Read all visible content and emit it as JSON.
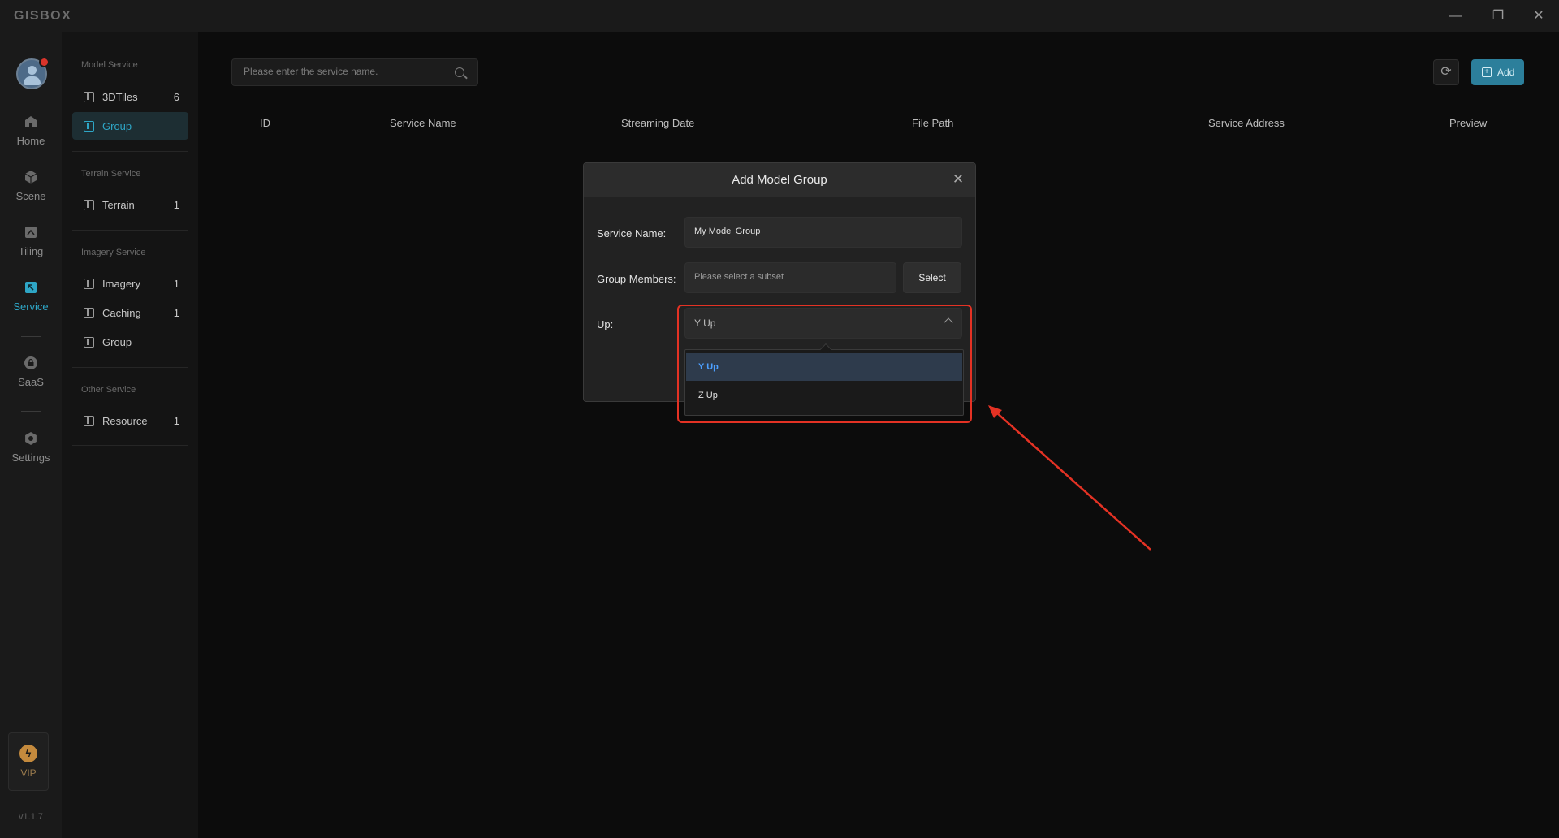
{
  "app": {
    "logo": "GISBOX",
    "version": "v1.1.7"
  },
  "window_controls": {
    "minimize": "—",
    "restore": "❐",
    "close": "✕"
  },
  "rail": {
    "items": [
      {
        "label": "Home",
        "icon": "home-icon"
      },
      {
        "label": "Scene",
        "icon": "cube-icon"
      },
      {
        "label": "Tiling",
        "icon": "tiling-icon"
      },
      {
        "label": "Service",
        "icon": "service-icon",
        "active": true
      },
      {
        "label": "SaaS",
        "icon": "lock-icon"
      },
      {
        "label": "Settings",
        "icon": "gear-icon"
      }
    ],
    "vip_label": "VIP"
  },
  "sidebar": {
    "model_title": "Model Service",
    "model_items": [
      {
        "label": "3DTiles",
        "count": "6"
      },
      {
        "label": "Group",
        "count": ""
      }
    ],
    "terrain_title": "Terrain Service",
    "terrain_items": [
      {
        "label": "Terrain",
        "count": "1"
      }
    ],
    "imagery_title": "Imagery Service",
    "imagery_items": [
      {
        "label": "Imagery",
        "count": "1"
      },
      {
        "label": "Caching",
        "count": "1"
      },
      {
        "label": "Group",
        "count": ""
      }
    ],
    "other_title": "Other Service",
    "other_items": [
      {
        "label": "Resource",
        "count": "1"
      }
    ]
  },
  "toolbar": {
    "search_placeholder": "Please enter the service name.",
    "add_label": "Add"
  },
  "table": {
    "columns": [
      "ID",
      "Service Name",
      "Streaming Date",
      "File Path",
      "Service Address",
      "Preview"
    ]
  },
  "modal": {
    "title": "Add Model Group",
    "service_name_label": "Service Name:",
    "service_name_value": "My Model Group",
    "group_members_label": "Group Members:",
    "group_members_placeholder": "Please select a subset",
    "select_button": "Select",
    "up_label": "Up:",
    "up_value": "Y Up",
    "up_options": [
      "Y Up",
      "Z Up"
    ]
  },
  "colors": {
    "accent": "#2ea6c6",
    "add_button": "#2c7f9b",
    "annotation": "#e43224",
    "selected_option_text": "#4c9fff"
  }
}
